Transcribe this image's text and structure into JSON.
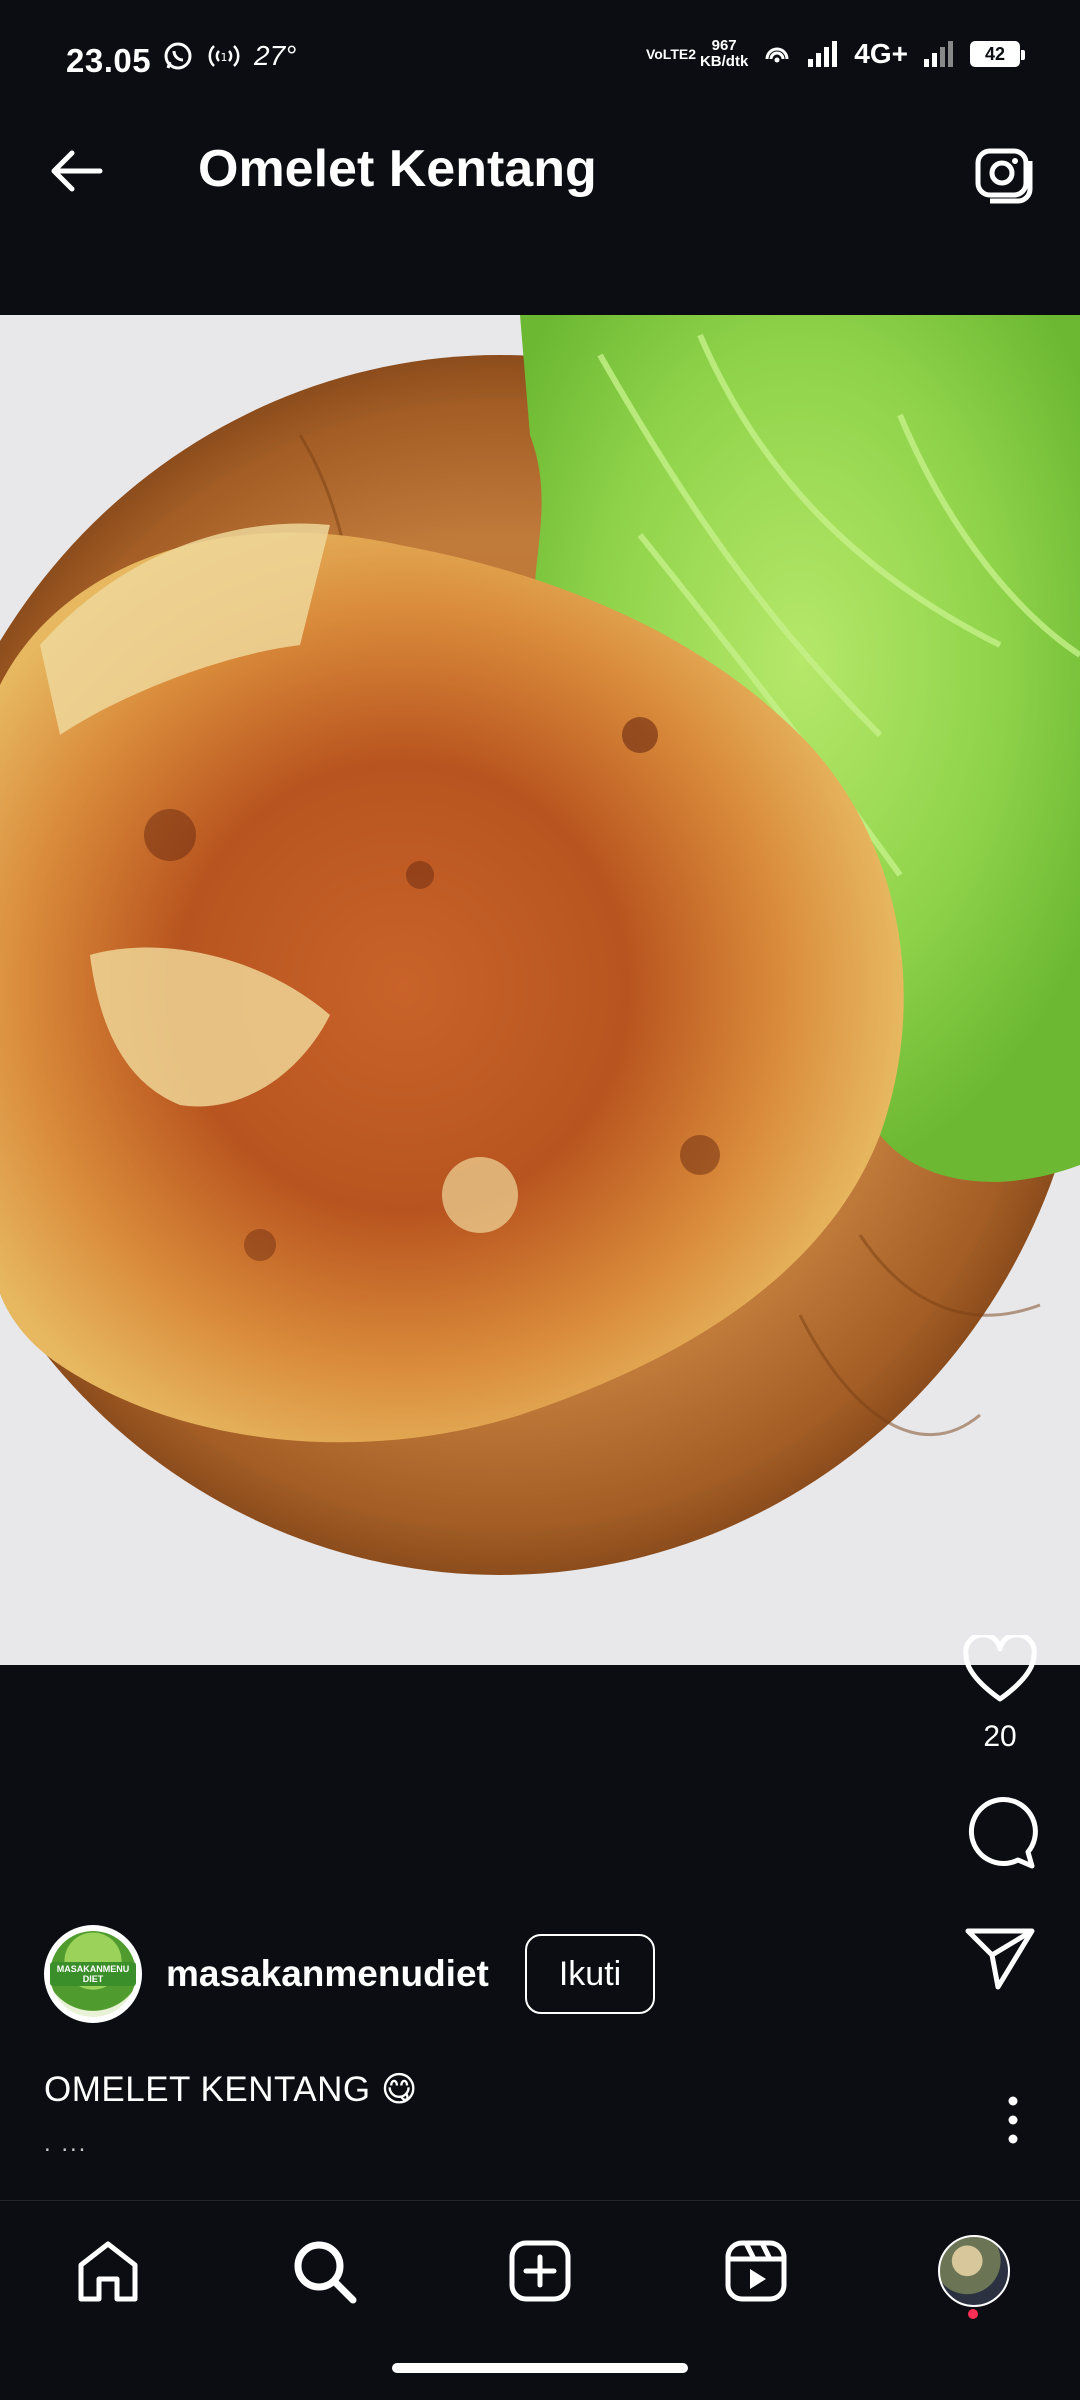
{
  "status_bar": {
    "time": "23.05",
    "temperature": "27°",
    "net_type": "VoLTE2",
    "speed": "967",
    "speed_unit": "KB/dtk",
    "network": "4G+",
    "battery": "42"
  },
  "header": {
    "title": "Omelet Kentang"
  },
  "post": {
    "like_count": "20",
    "author": "masakanmenudiet",
    "avatar_text": "MASAKANMENU DIET",
    "follow_label": "Ikuti",
    "caption": "OMELET KENTANG 😋",
    "caption_more": ". ..."
  },
  "colors": {
    "background": "#0b0d12",
    "notification_dot": "#ff2e55"
  },
  "icons": {
    "back": "arrow-left-icon",
    "camera": "camera-icon",
    "like": "heart-icon",
    "comment": "comment-icon",
    "share": "send-icon",
    "more": "more-vertical-icon",
    "home": "home-icon",
    "search": "search-icon",
    "create": "plus-square-icon",
    "reels": "reels-icon"
  }
}
